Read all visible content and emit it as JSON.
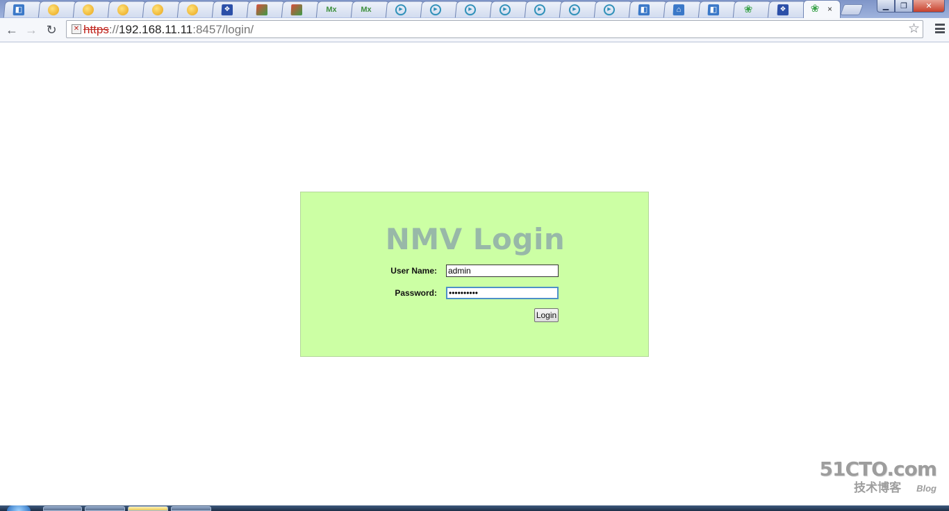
{
  "browser": {
    "tabs": [
      {
        "icon": "blue-app-icon"
      },
      {
        "icon": "yellow-globe-icon"
      },
      {
        "icon": "yellow-globe-icon"
      },
      {
        "icon": "yellow-globe-icon"
      },
      {
        "icon": "yellow-globe-icon"
      },
      {
        "icon": "yellow-globe-icon"
      },
      {
        "icon": "paw-icon"
      },
      {
        "icon": "book-icon"
      },
      {
        "icon": "book-icon"
      },
      {
        "icon": "mx-icon",
        "glyph": "Mx"
      },
      {
        "icon": "mx-icon",
        "glyph": "Mx"
      },
      {
        "icon": "play-circle-icon"
      },
      {
        "icon": "play-circle-icon"
      },
      {
        "icon": "play-circle-icon"
      },
      {
        "icon": "play-circle-icon"
      },
      {
        "icon": "play-circle-icon"
      },
      {
        "icon": "play-circle-icon"
      },
      {
        "icon": "play-circle-icon"
      },
      {
        "icon": "blue-app-icon"
      },
      {
        "icon": "home-icon"
      },
      {
        "icon": "blue-app-icon"
      },
      {
        "icon": "green-swirl-icon"
      },
      {
        "icon": "paw-icon"
      }
    ],
    "active_tab": {
      "icon": "green-swirl-icon",
      "close_glyph": "×"
    },
    "window_controls": {
      "minimize": "▁",
      "maximize": "❐",
      "close": "✕"
    },
    "nav": {
      "back": "←",
      "forward": "→",
      "reload": "↻"
    },
    "address": {
      "scheme": "https",
      "separator": "://",
      "host": "192.168.11.11",
      "port_path": ":8457/login/",
      "security_glyph": "✕"
    },
    "star_glyph": "☆"
  },
  "login": {
    "title": "NMV Login",
    "username_label": "User Name:",
    "username_value": "admin",
    "password_label": "Password:",
    "password_value": "••••••••••",
    "submit_label": "Login"
  },
  "watermark": {
    "main": "51CTO.com",
    "sub": "技术博客",
    "blog": "Blog"
  },
  "colors": {
    "panel_bg": "#ccffa4",
    "title_color": "#98b8a8",
    "insecure_scheme": "#c0261f",
    "focus_ring": "#4d90c8"
  }
}
